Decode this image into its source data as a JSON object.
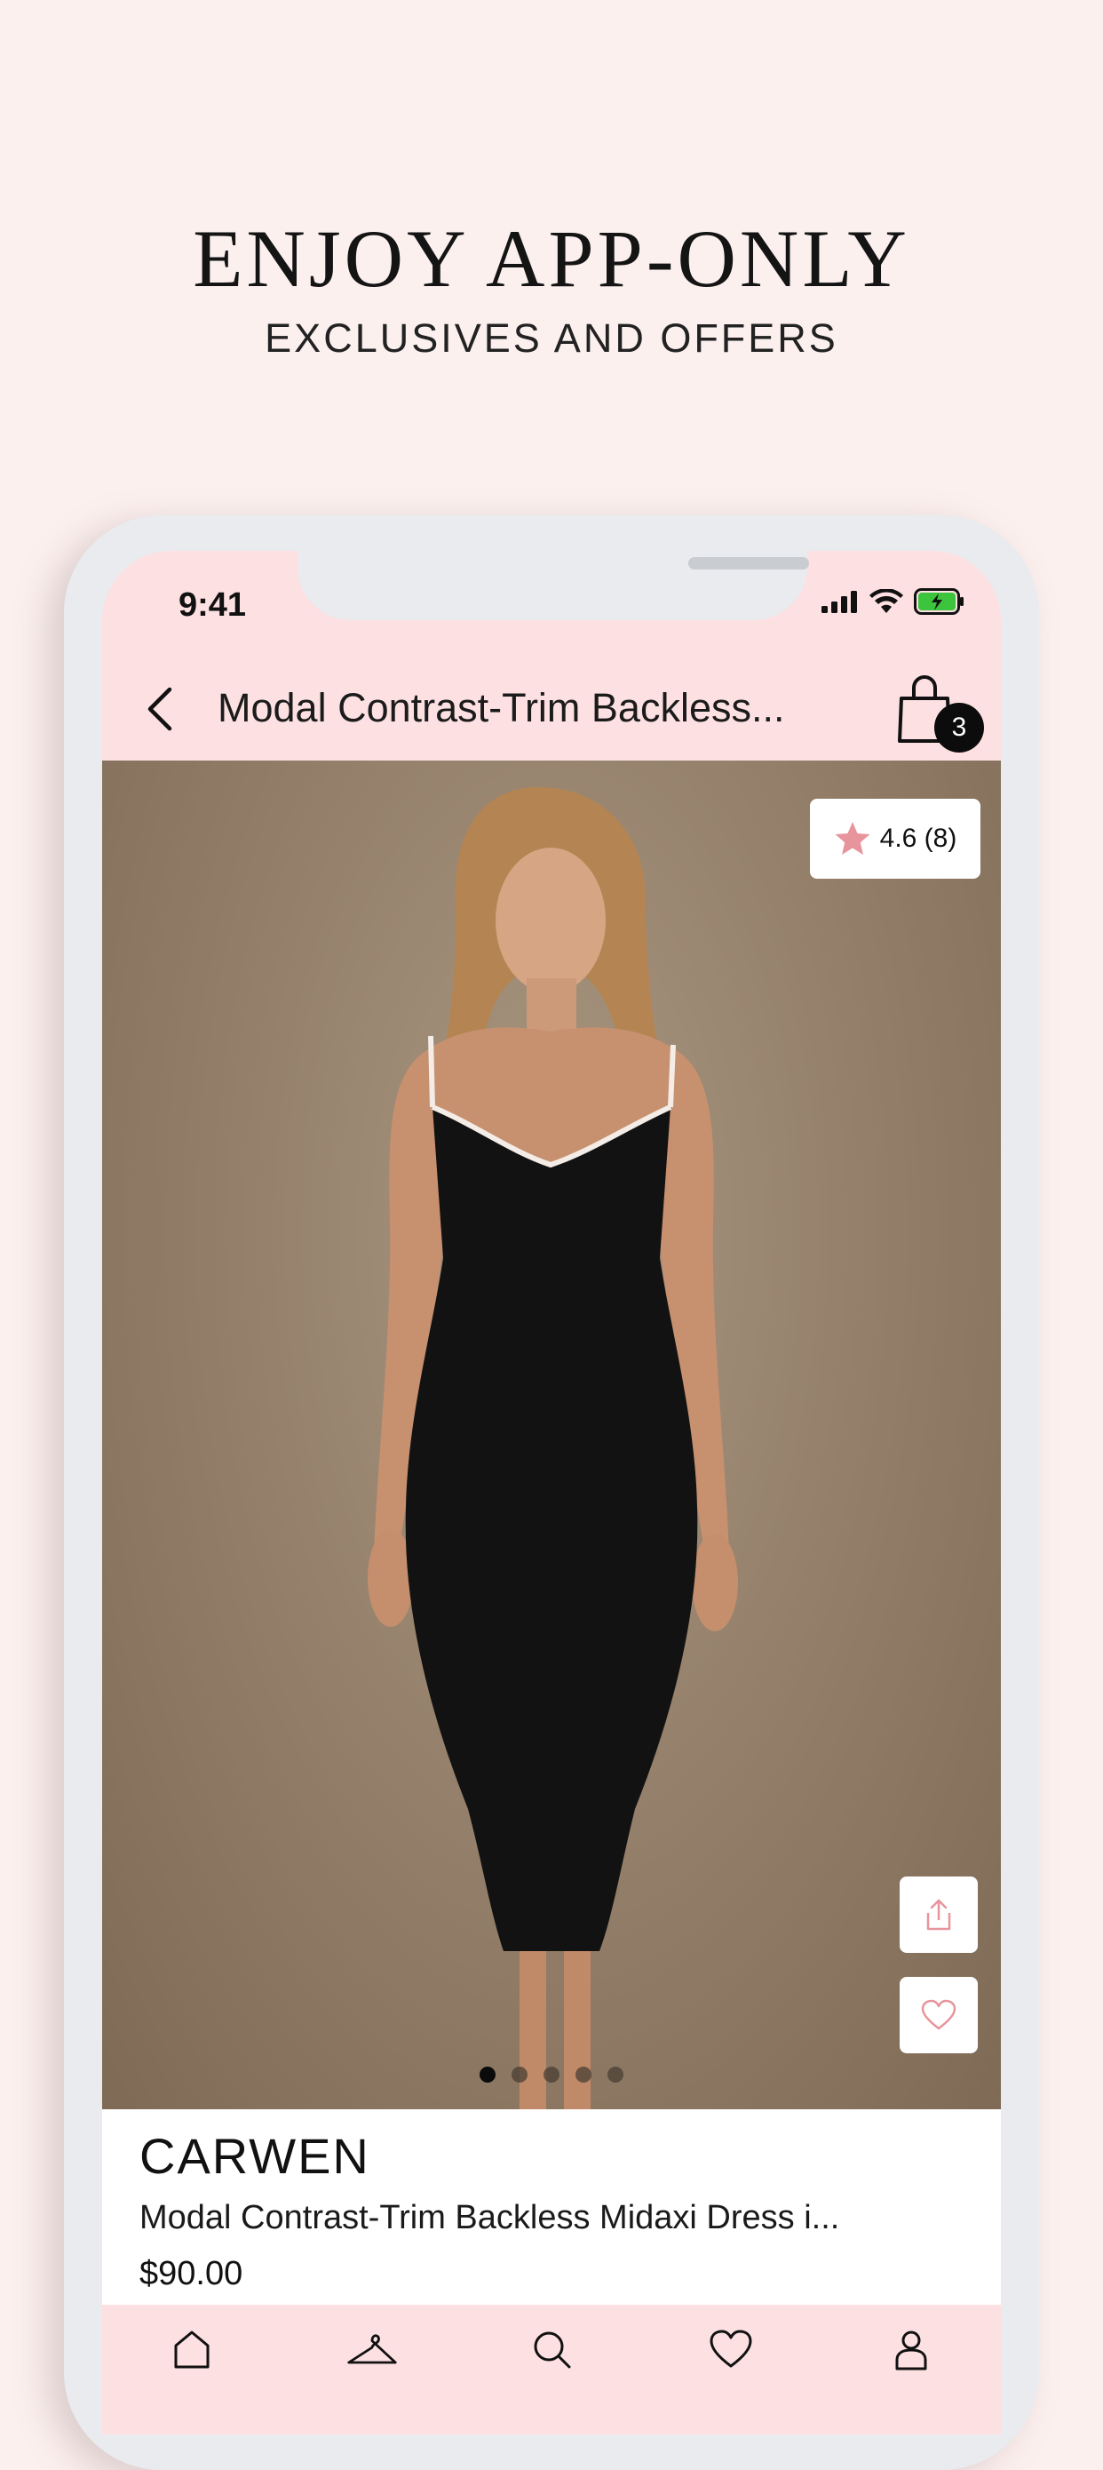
{
  "promo": {
    "headline": "ENJOY APP-ONLY",
    "subheadline": "EXCLUSIVES AND OFFERS"
  },
  "status_bar": {
    "time": "9:41",
    "icons": [
      "signal-icon",
      "wifi-icon",
      "battery-charging-icon"
    ]
  },
  "nav": {
    "back_icon": "chevron-left-icon",
    "title": "Modal Contrast-Trim Backless...",
    "bag_icon": "shopping-bag-icon",
    "bag_count": "3"
  },
  "gallery": {
    "rating_icon": "star-icon",
    "rating_text": "4.6 (8)",
    "share_icon": "share-icon",
    "favorite_icon": "heart-icon",
    "page_count": 5,
    "active_page": 1
  },
  "product": {
    "brand": "CARWEN",
    "name": "Modal Contrast-Trim Backless Midaxi Dress i...",
    "price": "$90.00"
  },
  "tabbar": {
    "items": [
      {
        "icon": "home-icon"
      },
      {
        "icon": "hanger-icon"
      },
      {
        "icon": "search-icon"
      },
      {
        "icon": "heart-icon"
      },
      {
        "icon": "account-icon"
      }
    ]
  },
  "colors": {
    "page_background": "#fcf0ef",
    "app_pink": "#fde0e2",
    "star_pink": "#e8949c",
    "text": "#111111"
  }
}
